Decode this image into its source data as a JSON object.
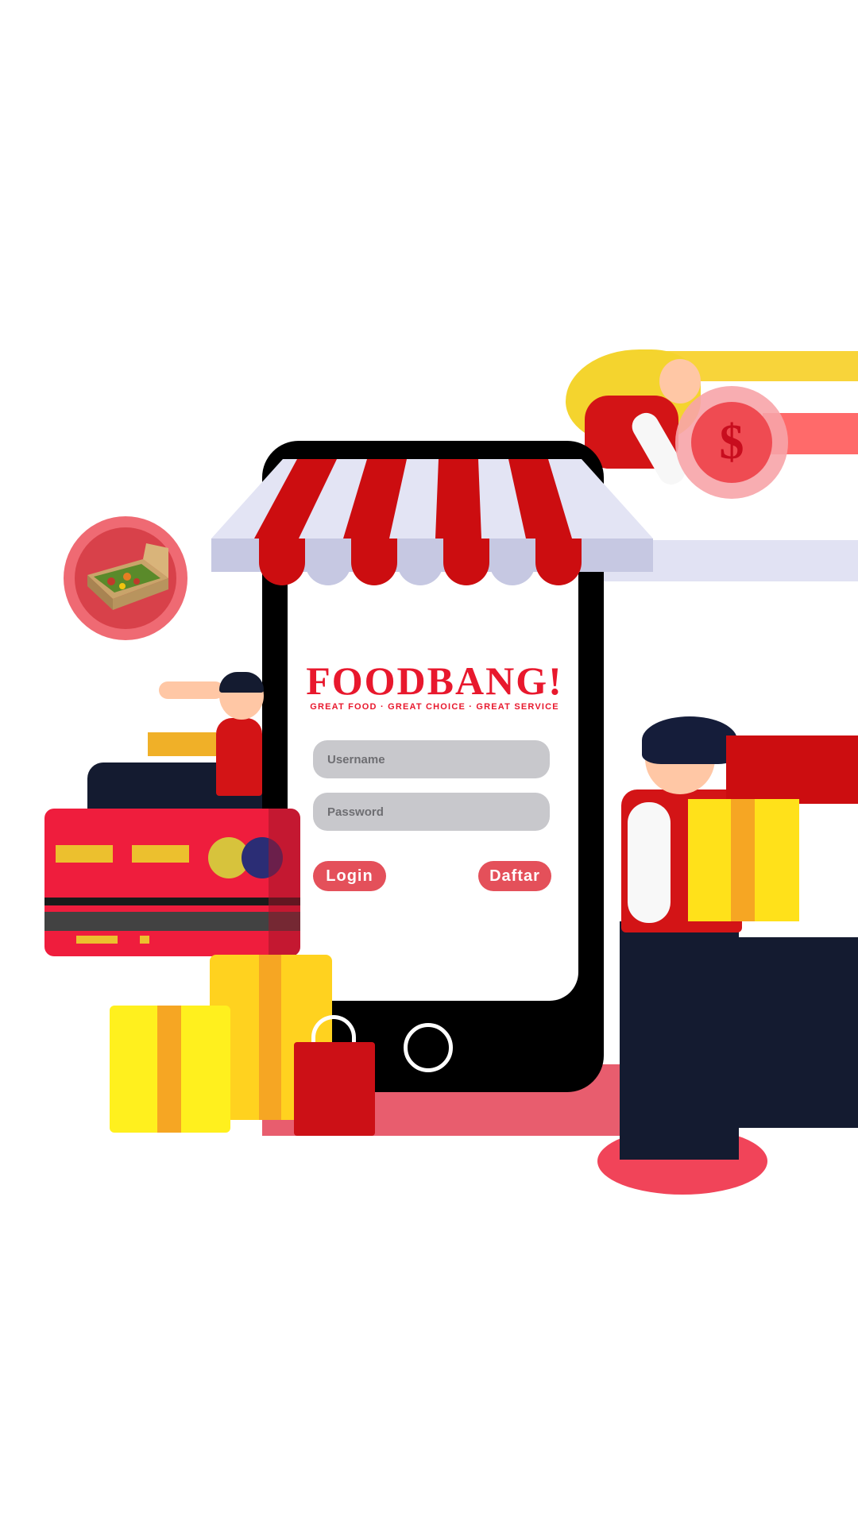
{
  "app": {
    "brand_name": "FOODBANG!",
    "tagline": "GREAT FOOD · GREAT CHOICE · GREAT SERVICE"
  },
  "login_form": {
    "username_placeholder": "Username",
    "password_placeholder": "Password",
    "login_label": "Login",
    "register_label": "Daftar"
  },
  "decor": {
    "coin_symbol": "$",
    "icons": [
      "food-box-icon",
      "coin-icon",
      "credit-card-icon",
      "gift-box-icon",
      "shopping-bag-icon",
      "store-awning-icon"
    ]
  },
  "colors": {
    "brand_red": "#e8182d",
    "button_red": "#e4505a",
    "input_gray": "#c8c8cc"
  }
}
